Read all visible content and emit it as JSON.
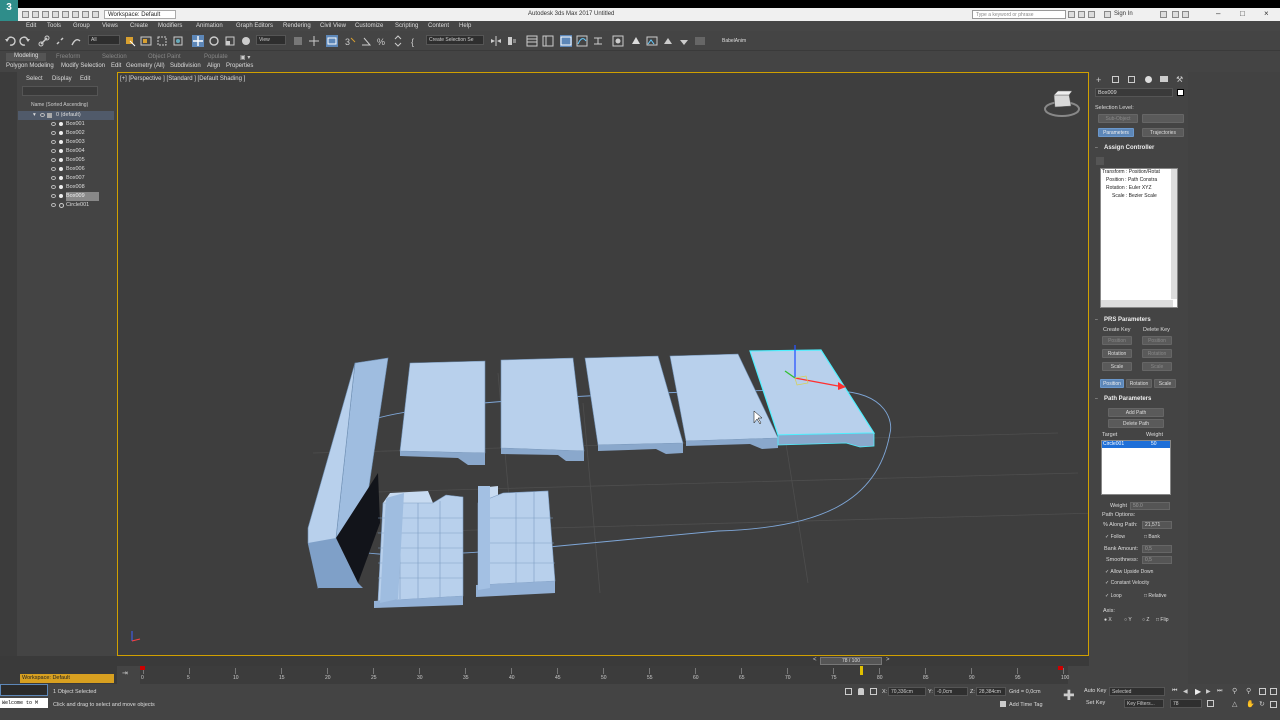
{
  "app": {
    "title": "Autodesk 3ds Max 2017    Untitled",
    "workspace": "Workspace: Default",
    "search_placeholder": "Type a keyword or phrase",
    "sign_in": "Sign In",
    "logo": "3",
    "logo_sub": "MAX"
  },
  "menu": [
    "Edit",
    "Tools",
    "Group",
    "Views",
    "Create",
    "Modifiers",
    "Animation",
    "Graph Editors",
    "Rendering",
    "Civil View",
    "Customize",
    "Scripting",
    "Content",
    "Help"
  ],
  "toolbar": {
    "filter_all": "All",
    "ref_coord": "View",
    "selection_set": "Create Selection Se",
    "babel": "BabelAnim"
  },
  "ribbon": {
    "tabs": [
      "Modeling",
      "Freeform",
      "Selection",
      "Object Paint",
      "Populate"
    ],
    "sub": [
      "Polygon Modeling",
      "Modify Selection",
      "Edit",
      "Geometry (All)",
      "Subdivision",
      "Align",
      "Properties"
    ]
  },
  "explorer": {
    "tabs": [
      "Select",
      "Display",
      "Edit"
    ],
    "header": "Name (Sorted Ascending)",
    "layer": "0 (default)",
    "items": [
      "Box001",
      "Box002",
      "Box003",
      "Box004",
      "Box005",
      "Box006",
      "Box007",
      "Box008",
      "Box009",
      "Circle001"
    ]
  },
  "viewport": {
    "label": "[+] [Perspective ] [Standard ] [Default Shading ]"
  },
  "command_panel": {
    "object_name": "Box009",
    "selection_level": "Selection Level:",
    "sub_object": "Sub-Object",
    "tabs": [
      "Parameters",
      "Trajectories"
    ],
    "assign_controller": "Assign Controller",
    "controller_tree": [
      "Transform : Position/Rotat",
      "Position : Path Constra",
      "Rotation : Euler XYZ",
      "Scale : Bezier Scale"
    ],
    "prs_parameters": "PRS Parameters",
    "create_key": "Create Key",
    "delete_key": "Delete Key",
    "key_buttons": [
      "Position",
      "Rotation",
      "Scale"
    ],
    "prs_tabs": [
      "Position",
      "Rotation",
      "Scale"
    ],
    "path_parameters": "Path Parameters",
    "add_path": "Add Path",
    "delete_path": "Delete Path",
    "target_header": "Target",
    "weight_header": "Weight",
    "target_row": {
      "target": "Circle001",
      "weight": "50"
    },
    "weight_label": "Weight",
    "weight_value": "50.0",
    "path_options": "Path Options:",
    "along_path_label": "% Along Path:",
    "along_path_value": "21,571",
    "follow": "Follow",
    "bank": "Bank",
    "bank_amount_label": "Bank Amount:",
    "bank_amount_value": "0,5",
    "smoothness_label": "Smoothness:",
    "smoothness_value": "0,5",
    "allow_upside_down": "Allow Upside Down",
    "constant_velocity": "Constant Velocity",
    "loop": "Loop",
    "relative": "Relative",
    "axis": "Axis:",
    "axis_options": [
      "X",
      "Y",
      "Z",
      "Flip"
    ]
  },
  "timeline": {
    "frame": "78 / 100",
    "current_frame": 78,
    "total_frames": 100,
    "ticks": [
      "0",
      "5",
      "10",
      "15",
      "20",
      "25",
      "30",
      "35",
      "40",
      "45",
      "50",
      "55",
      "60",
      "65",
      "70",
      "75",
      "80",
      "85",
      "90",
      "95",
      "100"
    ]
  },
  "status": {
    "workspace": "Workspace: Default",
    "listener": "Welcome to M",
    "objects_selected": "1 Object Selected",
    "prompt": "Click and drag to select and move objects",
    "x_label": "X:",
    "x_value": "70,336cm",
    "y_label": "Y:",
    "y_value": "-0,0cm",
    "z_label": "Z:",
    "z_value": "28,384cm",
    "grid": "Grid = 0,0cm",
    "add_time_tag": "Add Time Tag",
    "auto_key": "Auto Key",
    "set_key": "Set Key",
    "selected": "Selected",
    "key_filters": "Key Filters...",
    "frame_field": "78"
  }
}
